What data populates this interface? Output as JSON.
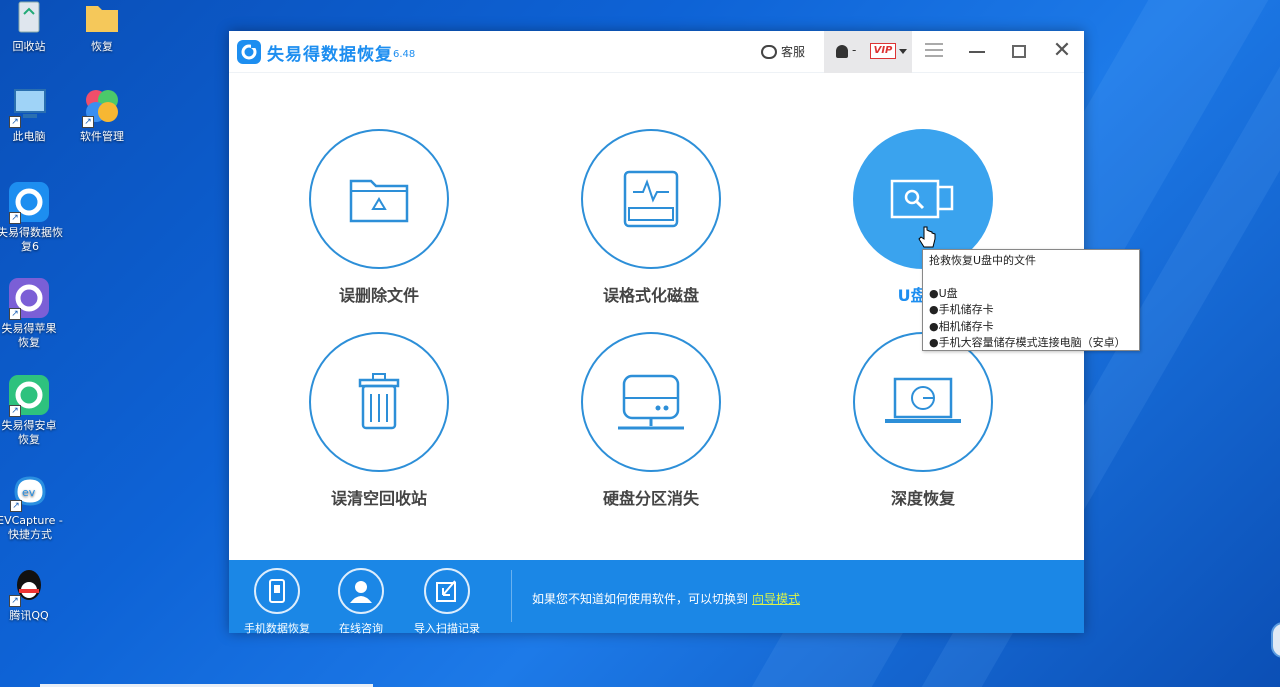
{
  "desktop": {
    "icons": [
      {
        "label": "回收站",
        "icon": "recycle-bin-icon"
      },
      {
        "label": "恢复",
        "icon": "folder-icon"
      },
      {
        "label": "此电脑",
        "icon": "computer-icon"
      },
      {
        "label": "软件管理",
        "icon": "software-manager-icon"
      },
      {
        "label": "失易得数据恢复6",
        "icon": "data-recovery-app-icon"
      },
      {
        "label": "失易得苹果恢复",
        "icon": "apple-recovery-app-icon"
      },
      {
        "label": "失易得安卓恢复",
        "icon": "android-recovery-app-icon"
      },
      {
        "label": "EVCapture - 快捷方式",
        "icon": "evcapture-icon"
      },
      {
        "label": "腾讯QQ",
        "icon": "qq-icon"
      }
    ]
  },
  "window": {
    "title": "失易得数据恢复",
    "version": "6.48",
    "service_label": "客服",
    "user_dash": "-",
    "vip_label": "VIP",
    "accent": "#1d8ef0"
  },
  "features": [
    {
      "label": "误删除文件",
      "icon": "folder-recycle-icon"
    },
    {
      "label": "误格式化磁盘",
      "icon": "disk-format-icon"
    },
    {
      "label": "U盘/储",
      "icon": "usb-search-icon"
    },
    {
      "label": "误清空回收站",
      "icon": "trash-bin-icon"
    },
    {
      "label": "硬盘分区消失",
      "icon": "hard-drive-icon"
    },
    {
      "label": "深度恢复",
      "icon": "laptop-scan-icon"
    }
  ],
  "tooltip": {
    "title": "抢救恢复U盘中的文件",
    "items": [
      "●U盘",
      "●手机储存卡",
      "●相机储存卡",
      "●手机大容量储存模式连接电脑（安卓）"
    ]
  },
  "bottombar": {
    "items": [
      {
        "label": "手机数据恢复",
        "icon": "phone-icon"
      },
      {
        "label": "在线咨询",
        "icon": "user-consult-icon"
      },
      {
        "label": "导入扫描记录",
        "icon": "import-icon"
      }
    ],
    "tip_text": "如果您不知道如何使用软件，可以切换到",
    "tip_link": "向导模式"
  }
}
